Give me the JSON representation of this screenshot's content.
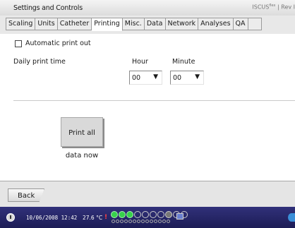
{
  "window": {
    "title": "Settings and Controls",
    "brand": "ISCUS",
    "brand_sup": "flex",
    "brand_suffix": "| Rev I"
  },
  "tabs": [
    "Scaling",
    "Units",
    "Catheter",
    "Printing",
    "Misc.",
    "Data",
    "Network",
    "Analyses",
    "QA",
    ""
  ],
  "active_tab": "Printing",
  "printing": {
    "auto_print_label": "Automatic print out",
    "auto_print_checked": false,
    "daily_print_time_label": "Daily print time",
    "hour_label": "Hour",
    "minute_label": "Minute",
    "hour_value": "00",
    "minute_value": "00",
    "print_all_label_line1": "Print all",
    "print_all_label_line2": "data now"
  },
  "footer": {
    "back_label": "Back"
  },
  "status": {
    "datetime": "10/06/2008 12:42",
    "temperature": "27.6 °C",
    "alert_symbol": "!",
    "samples": [
      "filled",
      "filled",
      "filled",
      "empty",
      "empty",
      "empty",
      "empty",
      "dark",
      "empty",
      "empty"
    ]
  },
  "icons": {
    "dropdown": "arrow-down-icon",
    "power": "power-icon",
    "monitor": "monitor-icon",
    "network": "network-globe-icon"
  },
  "colors": {
    "status_bar": "#2a2a6e",
    "sample_filled": "#36d14b",
    "alert": "#ff4040"
  }
}
